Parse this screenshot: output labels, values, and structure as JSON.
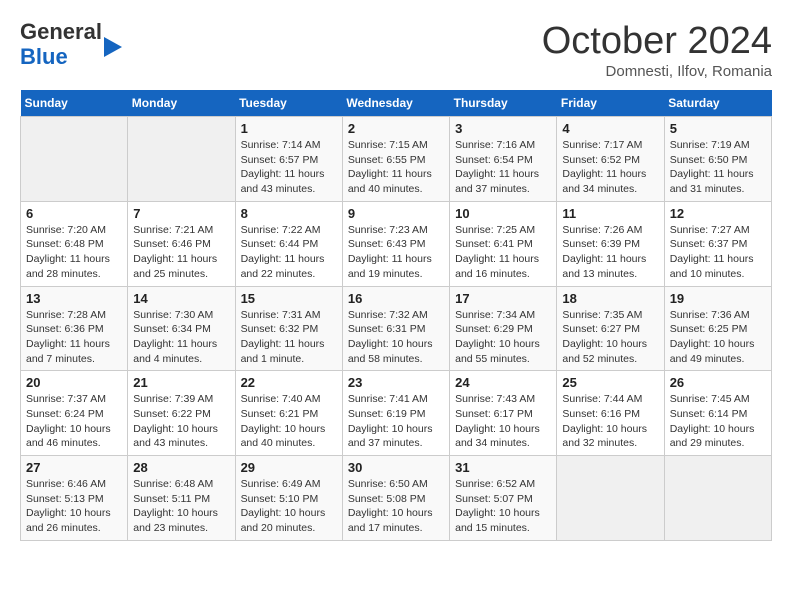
{
  "header": {
    "logo_line1": "General",
    "logo_line2": "Blue",
    "month": "October 2024",
    "location": "Domnesti, Ilfov, Romania"
  },
  "days_of_week": [
    "Sunday",
    "Monday",
    "Tuesday",
    "Wednesday",
    "Thursday",
    "Friday",
    "Saturday"
  ],
  "weeks": [
    [
      {
        "day": "",
        "content": ""
      },
      {
        "day": "",
        "content": ""
      },
      {
        "day": "1",
        "content": "Sunrise: 7:14 AM\nSunset: 6:57 PM\nDaylight: 11 hours and 43 minutes."
      },
      {
        "day": "2",
        "content": "Sunrise: 7:15 AM\nSunset: 6:55 PM\nDaylight: 11 hours and 40 minutes."
      },
      {
        "day": "3",
        "content": "Sunrise: 7:16 AM\nSunset: 6:54 PM\nDaylight: 11 hours and 37 minutes."
      },
      {
        "day": "4",
        "content": "Sunrise: 7:17 AM\nSunset: 6:52 PM\nDaylight: 11 hours and 34 minutes."
      },
      {
        "day": "5",
        "content": "Sunrise: 7:19 AM\nSunset: 6:50 PM\nDaylight: 11 hours and 31 minutes."
      }
    ],
    [
      {
        "day": "6",
        "content": "Sunrise: 7:20 AM\nSunset: 6:48 PM\nDaylight: 11 hours and 28 minutes."
      },
      {
        "day": "7",
        "content": "Sunrise: 7:21 AM\nSunset: 6:46 PM\nDaylight: 11 hours and 25 minutes."
      },
      {
        "day": "8",
        "content": "Sunrise: 7:22 AM\nSunset: 6:44 PM\nDaylight: 11 hours and 22 minutes."
      },
      {
        "day": "9",
        "content": "Sunrise: 7:23 AM\nSunset: 6:43 PM\nDaylight: 11 hours and 19 minutes."
      },
      {
        "day": "10",
        "content": "Sunrise: 7:25 AM\nSunset: 6:41 PM\nDaylight: 11 hours and 16 minutes."
      },
      {
        "day": "11",
        "content": "Sunrise: 7:26 AM\nSunset: 6:39 PM\nDaylight: 11 hours and 13 minutes."
      },
      {
        "day": "12",
        "content": "Sunrise: 7:27 AM\nSunset: 6:37 PM\nDaylight: 11 hours and 10 minutes."
      }
    ],
    [
      {
        "day": "13",
        "content": "Sunrise: 7:28 AM\nSunset: 6:36 PM\nDaylight: 11 hours and 7 minutes."
      },
      {
        "day": "14",
        "content": "Sunrise: 7:30 AM\nSunset: 6:34 PM\nDaylight: 11 hours and 4 minutes."
      },
      {
        "day": "15",
        "content": "Sunrise: 7:31 AM\nSunset: 6:32 PM\nDaylight: 11 hours and 1 minute."
      },
      {
        "day": "16",
        "content": "Sunrise: 7:32 AM\nSunset: 6:31 PM\nDaylight: 10 hours and 58 minutes."
      },
      {
        "day": "17",
        "content": "Sunrise: 7:34 AM\nSunset: 6:29 PM\nDaylight: 10 hours and 55 minutes."
      },
      {
        "day": "18",
        "content": "Sunrise: 7:35 AM\nSunset: 6:27 PM\nDaylight: 10 hours and 52 minutes."
      },
      {
        "day": "19",
        "content": "Sunrise: 7:36 AM\nSunset: 6:25 PM\nDaylight: 10 hours and 49 minutes."
      }
    ],
    [
      {
        "day": "20",
        "content": "Sunrise: 7:37 AM\nSunset: 6:24 PM\nDaylight: 10 hours and 46 minutes."
      },
      {
        "day": "21",
        "content": "Sunrise: 7:39 AM\nSunset: 6:22 PM\nDaylight: 10 hours and 43 minutes."
      },
      {
        "day": "22",
        "content": "Sunrise: 7:40 AM\nSunset: 6:21 PM\nDaylight: 10 hours and 40 minutes."
      },
      {
        "day": "23",
        "content": "Sunrise: 7:41 AM\nSunset: 6:19 PM\nDaylight: 10 hours and 37 minutes."
      },
      {
        "day": "24",
        "content": "Sunrise: 7:43 AM\nSunset: 6:17 PM\nDaylight: 10 hours and 34 minutes."
      },
      {
        "day": "25",
        "content": "Sunrise: 7:44 AM\nSunset: 6:16 PM\nDaylight: 10 hours and 32 minutes."
      },
      {
        "day": "26",
        "content": "Sunrise: 7:45 AM\nSunset: 6:14 PM\nDaylight: 10 hours and 29 minutes."
      }
    ],
    [
      {
        "day": "27",
        "content": "Sunrise: 6:46 AM\nSunset: 5:13 PM\nDaylight: 10 hours and 26 minutes."
      },
      {
        "day": "28",
        "content": "Sunrise: 6:48 AM\nSunset: 5:11 PM\nDaylight: 10 hours and 23 minutes."
      },
      {
        "day": "29",
        "content": "Sunrise: 6:49 AM\nSunset: 5:10 PM\nDaylight: 10 hours and 20 minutes."
      },
      {
        "day": "30",
        "content": "Sunrise: 6:50 AM\nSunset: 5:08 PM\nDaylight: 10 hours and 17 minutes."
      },
      {
        "day": "31",
        "content": "Sunrise: 6:52 AM\nSunset: 5:07 PM\nDaylight: 10 hours and 15 minutes."
      },
      {
        "day": "",
        "content": ""
      },
      {
        "day": "",
        "content": ""
      }
    ]
  ]
}
